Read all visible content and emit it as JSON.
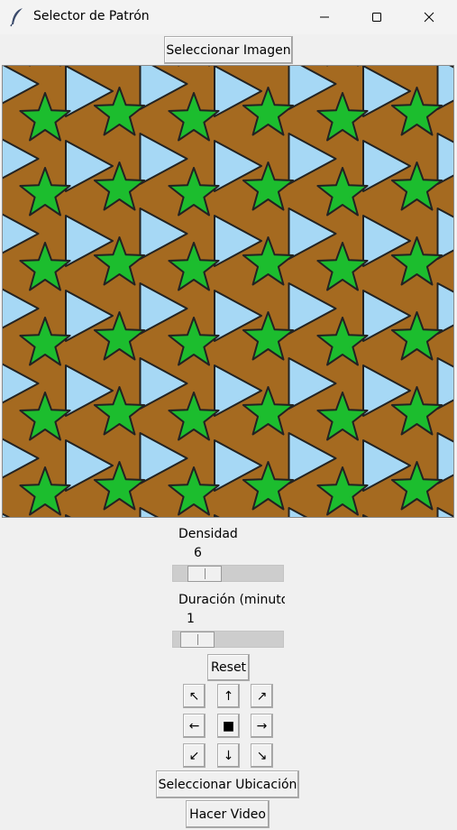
{
  "window": {
    "title": "Selector de Patrón",
    "icon": "feather-icon",
    "controls": [
      "minimize-icon",
      "maximize-icon",
      "close-icon"
    ]
  },
  "toolbar": {
    "select_image_label": "Seleccionar Imagen"
  },
  "canvas": {
    "background_color": "#a56a20",
    "shapes": [
      "triangle",
      "star"
    ],
    "triangle_color": "#a6d8f5",
    "star_color": "#1cbd2e",
    "outline_color": "#222222"
  },
  "density": {
    "label": "Densidad",
    "value": "6",
    "slider_fraction": 0.1
  },
  "duration": {
    "label": "Duración (minutos)",
    "value": "1",
    "slider_fraction": 0.0
  },
  "reset_label": "Reset",
  "direction_pad": {
    "nw": "↖",
    "n": "↑",
    "ne": "↗",
    "w": "←",
    "center": "■",
    "e": "→",
    "sw": "↙",
    "s": "↓",
    "se": "↘"
  },
  "select_location_label": "Seleccionar Ubicación",
  "make_video_label": "Hacer Video"
}
